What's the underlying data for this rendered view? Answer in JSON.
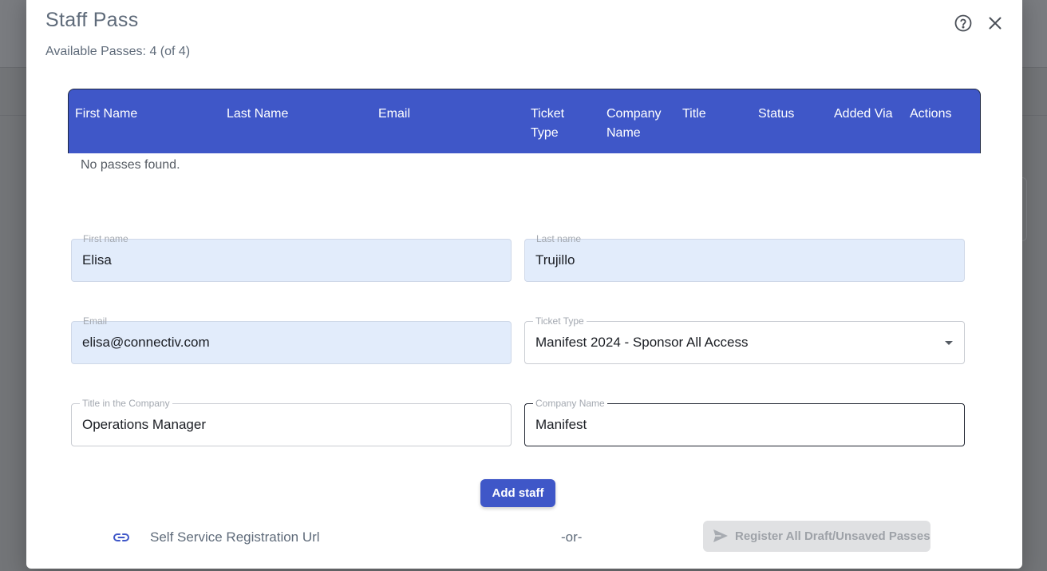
{
  "modal": {
    "title": "Staff Pass",
    "available_passes": "Available Passes: 4 (of 4)"
  },
  "table": {
    "columns": [
      "First Name",
      "Last Name",
      "Email",
      "Ticket Type",
      "Company Name",
      "Title",
      "Status",
      "Added Via",
      "Actions"
    ],
    "column_lines": [
      [
        "First Name"
      ],
      [
        "Last Name"
      ],
      [
        "Email"
      ],
      [
        "Ticket",
        "Type"
      ],
      [
        "Company",
        "Name"
      ],
      [
        "Title"
      ],
      [
        "Status"
      ],
      [
        "Added Via"
      ],
      [
        "Actions"
      ]
    ],
    "empty_text": "No passes found.",
    "header_color": "#3f57c8"
  },
  "form": {
    "first_name": {
      "label": "First name",
      "value": "Elisa"
    },
    "last_name": {
      "label": "Last name",
      "value": "Trujillo"
    },
    "email": {
      "label": "Email",
      "value": "elisa@connectiv.com"
    },
    "ticket_type": {
      "label": "Ticket Type",
      "value": "Manifest 2024 - Sponsor All Access"
    },
    "title_in_company": {
      "label": "Title in the Company",
      "value": "Operations Manager"
    },
    "company_name": {
      "label": "Company Name",
      "value": "Manifest"
    }
  },
  "actions": {
    "add_staff": "Add staff",
    "self_service_url": "Self Service Registration Url",
    "or_text": "-or-",
    "register_all": "Register All Draft/Unsaved Passes"
  },
  "icons": {
    "help": "help-circle-icon",
    "close": "close-icon",
    "link": "link-icon",
    "send": "send-icon"
  },
  "colors": {
    "primary": "#3f57c8",
    "autofill": "#e2ecfb",
    "disabled_bg": "#e0e1e3"
  }
}
